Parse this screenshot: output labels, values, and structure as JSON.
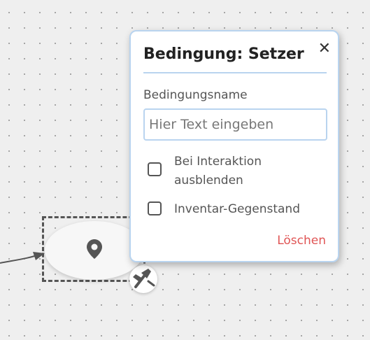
{
  "canvas": {
    "colors": {
      "background": "#efefef",
      "grid_dot": "#9a9a9a",
      "edge": "#555555"
    }
  },
  "node": {
    "icon": "map-pin-icon",
    "badge_icon": "hammer-wrench-icon"
  },
  "popup": {
    "title": "Bedingung: Setzer",
    "close_icon": "close-icon",
    "close_label": "✕",
    "name_field": {
      "label": "Bedingungsname",
      "value": "",
      "placeholder": "Hier Text eingeben"
    },
    "checkboxes": [
      {
        "label": "Bei Interaktion ausblenden",
        "checked": false
      },
      {
        "label": "Inventar-Gegenstand",
        "checked": false
      }
    ],
    "delete_label": "Löschen",
    "colors": {
      "accent": "#b9d4ef",
      "danger": "#e05555"
    }
  }
}
